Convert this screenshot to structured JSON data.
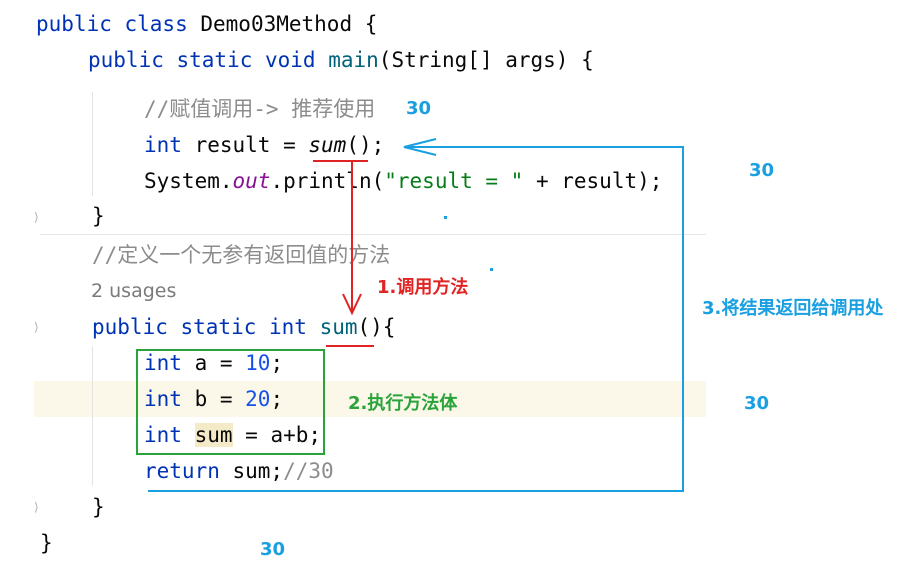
{
  "code": {
    "l1": {
      "kw": "public class ",
      "name": "Demo03Method",
      "rest": " {"
    },
    "l2": {
      "kw": "public static void ",
      "fn": "main",
      "rest": "(String[] args) {"
    },
    "l3": {
      "comment": "//赋值调用-> 推荐使用"
    },
    "l4": {
      "kw": "int",
      "a": " result = ",
      "call": "sum",
      "b": "();"
    },
    "l5": {
      "a": "System.",
      "field": "out",
      "b": ".println(",
      "str": "\"result = \"",
      "c": " + result);"
    },
    "l6": {
      "text": "}"
    },
    "l7": {
      "comment": "//定义一个无参有返回值的方法"
    },
    "usages": "2 usages",
    "l8": {
      "kw": "public static int ",
      "fn": "sum",
      "rest": "(){"
    },
    "l9": {
      "kw": "int",
      "a": " a = ",
      "num": "10",
      "b": ";"
    },
    "l10": {
      "kw": "int",
      "a": " b = ",
      "num": "20",
      "b": ";"
    },
    "l11": {
      "kw": "int",
      "a": " ",
      "var": "sum",
      "b": " = a+b;"
    },
    "l12": {
      "kw": "return",
      "a": " sum;",
      "comment": "//30"
    },
    "l13": {
      "text": "}"
    },
    "l14": {
      "text": "}"
    }
  },
  "annotations": {
    "call_value": "30",
    "right_top": "30",
    "right_mid": "30",
    "bottom": "30",
    "step1": "1.调用方法",
    "step2": "2.执行方法体",
    "step3": "3.将结果返回给调用处"
  },
  "colors": {
    "blue": "#1a9fe0",
    "red": "#e02424",
    "green": "#2aa33a"
  }
}
